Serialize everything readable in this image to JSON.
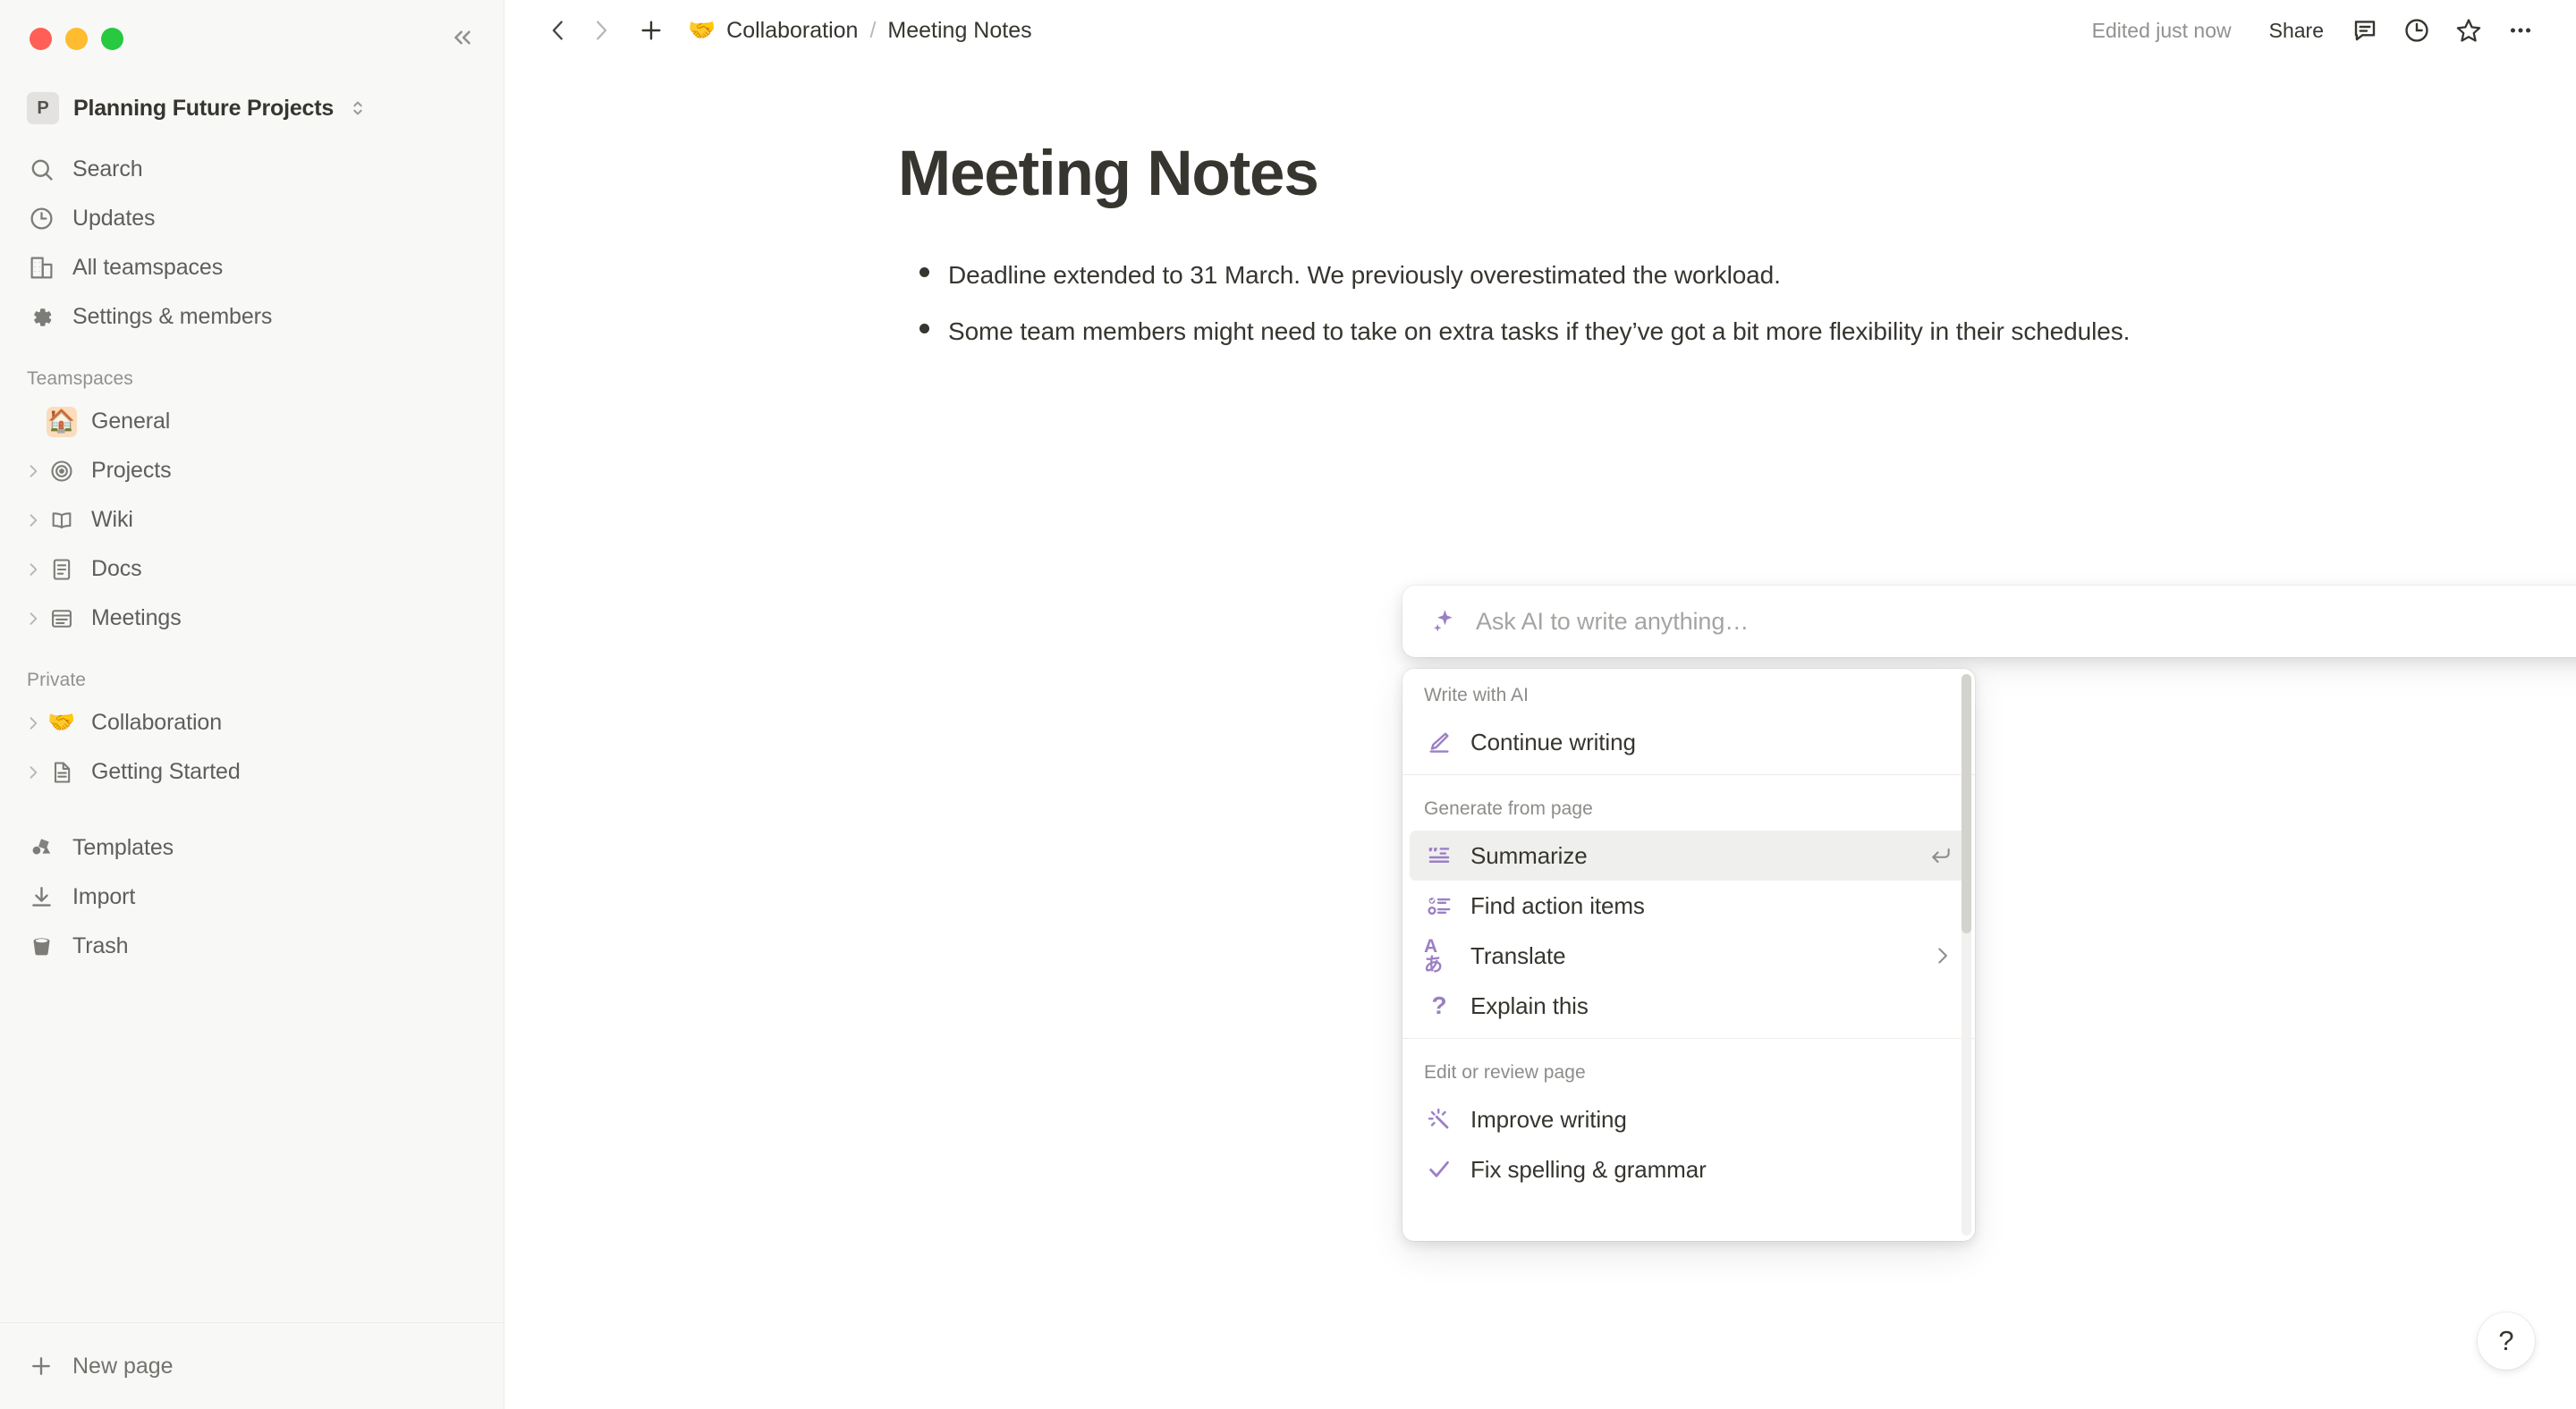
{
  "window": {
    "traffic_lights": [
      "close",
      "minimize",
      "maximize"
    ],
    "collapse_icon": "chevrons-left-icon"
  },
  "sidebar": {
    "workspace": {
      "initial": "P",
      "name": "Planning Future Projects",
      "caret_icon": "chevron-updown-icon"
    },
    "nav_items": [
      {
        "icon": "search-icon",
        "label": "Search"
      },
      {
        "icon": "clock-icon",
        "label": "Updates"
      },
      {
        "icon": "building-icon",
        "label": "All teamspaces"
      },
      {
        "icon": "gear-icon",
        "label": "Settings & members"
      }
    ],
    "teamspaces_title": "Teamspaces",
    "teamspaces": [
      {
        "icon": "house-emoji",
        "emoji": "🏠",
        "label": "General",
        "expandable": false
      },
      {
        "icon": "target-icon",
        "label": "Projects",
        "expandable": true
      },
      {
        "icon": "book-icon",
        "label": "Wiki",
        "expandable": true
      },
      {
        "icon": "document-icon",
        "label": "Docs",
        "expandable": true
      },
      {
        "icon": "list-card-icon",
        "label": "Meetings",
        "expandable": true
      }
    ],
    "private_title": "Private",
    "private": [
      {
        "icon": "handshake-emoji",
        "emoji": "🤝",
        "label": "Collaboration",
        "expandable": true
      },
      {
        "icon": "page-icon",
        "label": "Getting Started",
        "expandable": true
      }
    ],
    "bottom_items": [
      {
        "icon": "templates-icon",
        "label": "Templates"
      },
      {
        "icon": "download-icon",
        "label": "Import"
      },
      {
        "icon": "trash-icon",
        "label": "Trash"
      }
    ],
    "new_page": {
      "icon": "plus-icon",
      "label": "New page"
    }
  },
  "topbar": {
    "back_icon": "chevron-left-icon",
    "forward_icon": "chevron-right-icon",
    "add_icon": "plus-icon",
    "breadcrumb": {
      "parent_emoji": "🤝",
      "parent": "Collaboration",
      "separator": "/",
      "current": "Meeting Notes"
    },
    "edited_status": "Edited just now",
    "share_label": "Share",
    "icons": [
      "comment-icon",
      "history-clock-icon",
      "star-icon",
      "more-horizontal-icon"
    ]
  },
  "document": {
    "title": "Meeting Notes",
    "bullets": [
      "Deadline extended to 31 March. We previously overestimated the workload.",
      "Some team members might need to take on extra tasks if they’ve got a bit more flexibility in their schedules."
    ]
  },
  "ai_bar": {
    "spark_icon": "sparkle-icon",
    "placeholder": "Ask AI to write anything…",
    "send_icon": "arrow-up-circle-icon"
  },
  "ai_menu": {
    "groups": [
      {
        "header": "Write with AI",
        "items": [
          {
            "icon": "pencil-line-icon",
            "label": "Continue writing",
            "active": false,
            "trailing": "none"
          }
        ]
      },
      {
        "header": "Generate from page",
        "items": [
          {
            "icon": "summarize-icon",
            "label": "Summarize",
            "active": true,
            "trailing": "return-key-icon"
          },
          {
            "icon": "checklist-icon",
            "label": "Find action items",
            "active": false,
            "trailing": "none"
          },
          {
            "icon": "translate-icon",
            "icon_glyph": "Aあ",
            "label": "Translate",
            "active": false,
            "trailing": "chevron-right-icon"
          },
          {
            "icon": "question-mark-icon",
            "label": "Explain this",
            "active": false,
            "trailing": "none"
          }
        ]
      },
      {
        "header": "Edit or review page",
        "items": [
          {
            "icon": "sparkle-burst-icon",
            "label": "Improve writing",
            "active": false,
            "trailing": "none"
          },
          {
            "icon": "check-icon",
            "label": "Fix spelling & grammar",
            "active": false,
            "trailing": "none"
          }
        ]
      }
    ]
  },
  "help": {
    "icon": "question-mark-icon",
    "label": "?"
  },
  "colors": {
    "accent_purple": "#9b7fc4",
    "sidebar_bg": "#f8f8f7",
    "text_primary": "#37352f",
    "text_muted": "#91918e",
    "highlight_row": "#efefee"
  }
}
